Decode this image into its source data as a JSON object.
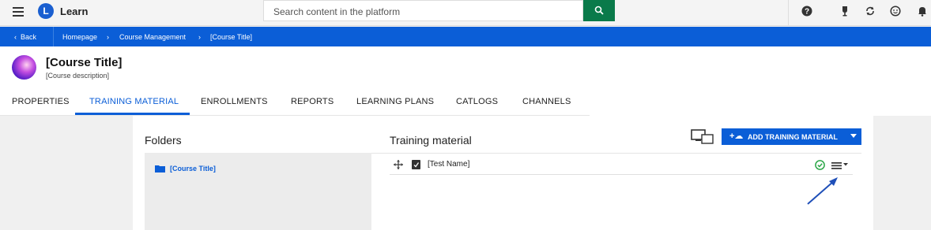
{
  "topbar": {
    "app_name": "Learn",
    "logo_letter": "L",
    "search_placeholder": "Search content in the platform",
    "icons": [
      "menu-icon",
      "help-icon",
      "trophy-icon",
      "sync-icon",
      "face-icon",
      "bell-icon"
    ]
  },
  "breadcrumb": {
    "back_label": "Back",
    "items": [
      "Homepage",
      "Course Management",
      "[Course Title]"
    ]
  },
  "course": {
    "title": "[Course Title]",
    "description": "[Course description]"
  },
  "tabs": [
    {
      "label": "PROPERTIES",
      "active": false
    },
    {
      "label": "TRAINING MATERIAL",
      "active": true
    },
    {
      "label": "ENROLLMENTS",
      "active": false
    },
    {
      "label": "REPORTS",
      "active": false
    },
    {
      "label": "LEARNING PLANS",
      "active": false
    },
    {
      "label": "CATLOGS",
      "active": false
    },
    {
      "label": "CHANNELS",
      "active": false
    }
  ],
  "folders": {
    "title": "Folders",
    "items": [
      "[Course Title]"
    ]
  },
  "training_material": {
    "title": "Training material",
    "add_button_label": "ADD TRAINING MATERIAL",
    "items": [
      {
        "name": "[Test Name]",
        "status": "published"
      }
    ]
  },
  "colors": {
    "primary": "#0b5ed7",
    "search_button": "#0a7a4a",
    "status_ok": "#2ea84a"
  }
}
